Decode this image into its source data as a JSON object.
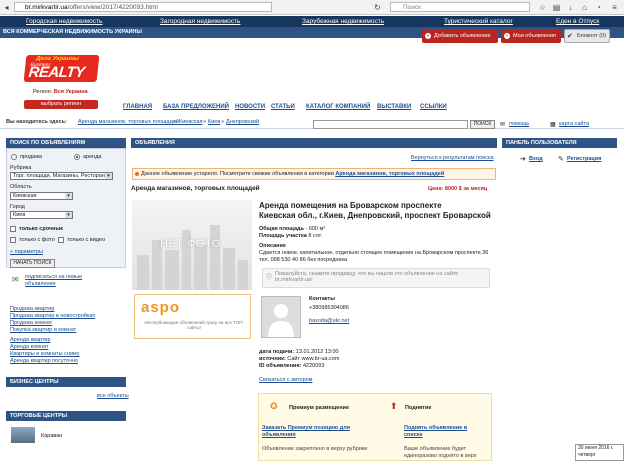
{
  "browser": {
    "url_host": "br.mirkvartir.ua",
    "url_path": "/offers/view/2017/4220093.html",
    "search_placeholder": "Поиск"
  },
  "topnav": [
    "Городская недвижимость",
    "Загородная недвижимость",
    "Зарубежная недвижимость",
    "Туристический каталог",
    "Еден в Отпуск"
  ],
  "subnav": {
    "title": "ВСЯ КОММЕРЧЕСКАЯ НЕДВИЖИМОСТЬ УКРАИНЫ",
    "add_offer": "Добавить объявление",
    "my_offers": "Мои объявления",
    "notepad": "Блокнот (0)"
  },
  "logo": {
    "top": "Дела Украины",
    "brand": "REALTY",
    "small": "Business"
  },
  "region": {
    "label": "Регион:",
    "value": "Вся Украина",
    "button": "выбрать регион"
  },
  "mainmenu": [
    "ГЛАВНАЯ",
    "БАЗА ПРЕДЛОЖЕНИЙ",
    "НОВОСТИ",
    "СТАТЬИ",
    "КАТАЛОГ КОМПАНИЙ",
    "ВЫСТАВКИ",
    "ССЫЛКИ"
  ],
  "breadcrumb": {
    "label": "Вы находитесь здесь:",
    "items": [
      "Аренда магазинов, торговых площадей",
      "Киевская",
      "Киев",
      "Днепровский"
    ]
  },
  "search": {
    "button": "ПОИСК",
    "help": "помощь",
    "map": "карта сайта"
  },
  "sidebar": {
    "search_header": "ПОИСК ПО ОБЪЯВЛЕНИЯМ",
    "radio_sale": "продажа",
    "radio_rent": "аренда",
    "rubric_label": "Рубрика",
    "rubric_value": "Торг. площади, Магазины, Рестораны",
    "region_label": "Область",
    "region_value": "Киевская",
    "city_label": "Город",
    "city_value": "Киев",
    "only_urgent": "только срочные",
    "only_photo": "только с фото",
    "only_video": "только с видео",
    "params": "» параметры",
    "start_search": "НАЧАТЬ ПОИСК",
    "subscribe": "подписаться на новые объявления",
    "links": [
      "Продажа квартир",
      "Продажа квартир в новостройках",
      "Продажа комнат",
      "Покупка квартир и комнат"
    ],
    "links2": [
      "Аренда квартир",
      "Аренда комнат",
      "Квартиры и комнаты сниму",
      "Аренда квартир посуточно"
    ],
    "biz_header": "БИЗНЕС ЦЕНТРЫ",
    "all_objects": "все объекты",
    "trade_header": "ТОРГОВЫЕ ЦЕНТРЫ",
    "trade_item": "Караван"
  },
  "content": {
    "header": "ОБЪЯВЛЕНИЯ",
    "back": "Вернуться к результатам поиска",
    "warning": "Данное объявление устарело. Посмотрите свежие объявления в категории",
    "warning_link": "Аренда магазинов, торговых площадей",
    "category": "Аренда магазинов, торговых площадей",
    "price": "Цена: 8000 $ за месяц",
    "no_photo": "НЕТ ФОТО",
    "aspo": "aspo",
    "aspo_desc": "Автопубликация объявлений сразу на все ТОП-сайты!",
    "title1": "Аренда помещения на Броварском проспекте",
    "title2": "Киевская обл., г.Киев, Днепровский, проспект Броварской",
    "area_label": "Общая площадь",
    "area_value": "- 600 м²",
    "plot_label": "Площадь участка",
    "plot_value": "8 сот.",
    "desc_label": "Описание",
    "desc": "Сдается новое, капитальное, отдельно стоящее помещение на Броварском проспекте,36 тел. 098 530 40 86 без посредника",
    "notice": "Пожалуйста, скажите продавцу, что вы нашли это объявление на сайте br.mirkvartir.ua!",
    "contacts_label": "Контакты",
    "phone": "+380985304086",
    "email": "bavoda@ukr.net",
    "date_label": "дата подачи:",
    "date_value": "13.01.2012 13:00",
    "source_label": "источник:",
    "source_value": "Сайт www.br-ua.com",
    "id_label": "ID объявления:",
    "id_value": "4220093",
    "contact_author": "Связаться с автором",
    "prem_title": "Премиум размещение",
    "prem_link": "Заказать Премиум позицию для объявления",
    "prem_desc": "Объявление закреплено в верху рубрики",
    "up_title": "Поднятие",
    "up_link": "Поднять объявление в списке",
    "up_desc": "Ваше объявление будет единоразово поднято в верх"
  },
  "rightbar": {
    "header": "ПАНЕЛЬ ПОЛЬЗОВАТЕЛЯ",
    "login": "Вход",
    "register": "Регистрация"
  },
  "clock": {
    "date": "30 июня 2016 г.",
    "day": "четверг"
  }
}
